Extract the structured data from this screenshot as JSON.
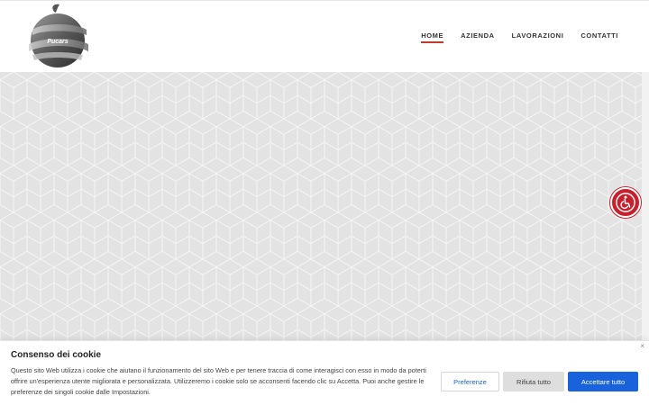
{
  "header": {
    "logo_text": "Pucars",
    "nav": [
      {
        "label": "HOME",
        "active": true
      },
      {
        "label": "AZIENDA",
        "active": false
      },
      {
        "label": "LAVORAZIONI",
        "active": false
      },
      {
        "label": "CONTATTI",
        "active": false
      }
    ]
  },
  "colors": {
    "accent": "#c0392b",
    "accessibility": "#c7202d",
    "primary_button": "#1863dc",
    "hero_background": "#e3e3e3"
  },
  "accessibility": {
    "icon": "wheelchair-icon"
  },
  "cookie": {
    "title": "Consenso dei cookie",
    "text": "Questo sito Web utilizza i cookie che aiutano il funzionamento del sito Web e per tenere traccia di come interagisci con esso in modo da poterti offrire un'esperienza utente migliorata e personalizzata. Utilizzeremo i cookie solo se acconsenti facendo clic su Accetta. Puoi anche gestire le preferenze dei singoli cookie dalle Impostazioni.",
    "close": "×",
    "preferences_label": "Preferenze",
    "reject_label": "Rifiuta tutto",
    "accept_label": "Accettare tutto"
  }
}
